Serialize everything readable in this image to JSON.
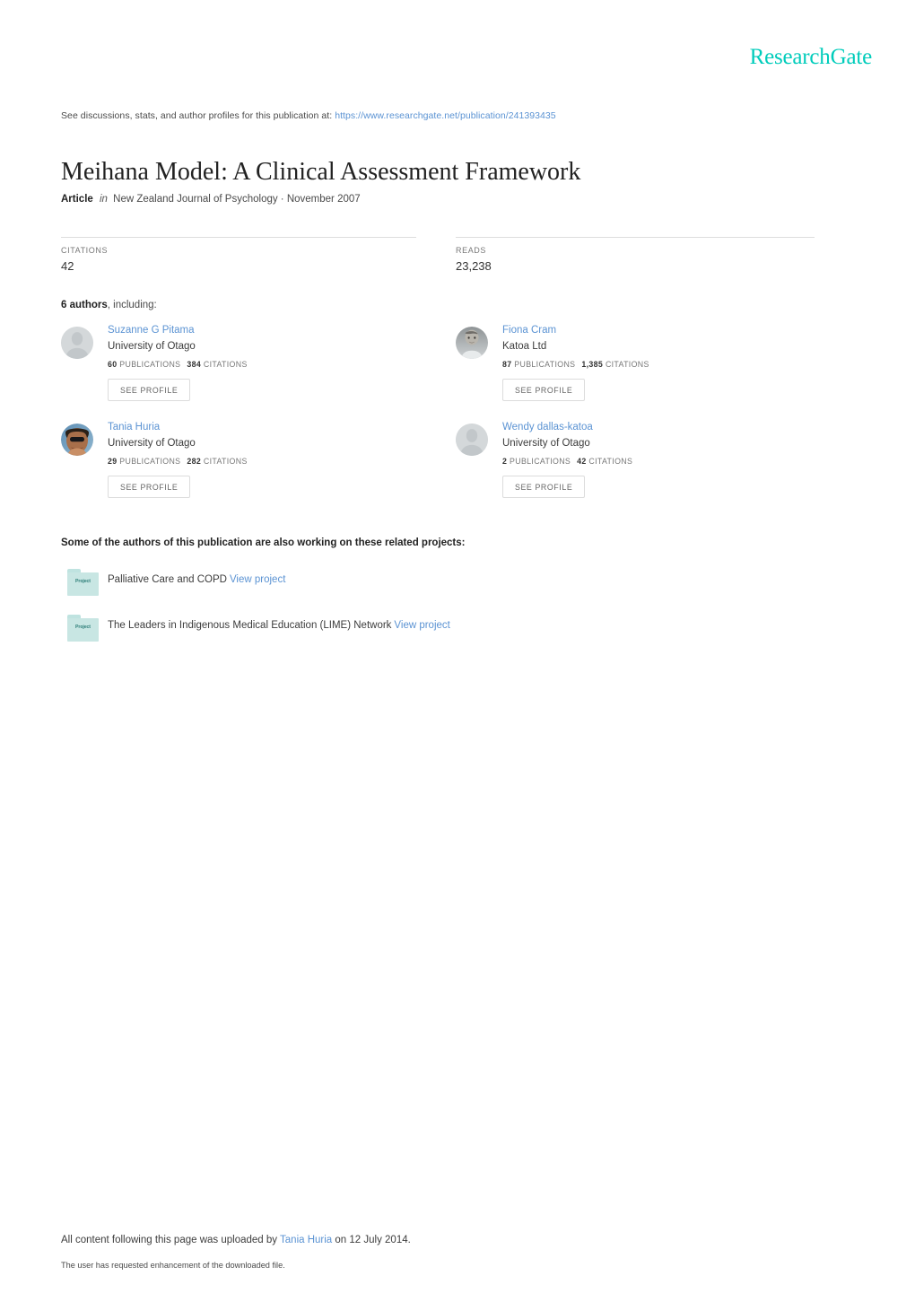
{
  "brand": {
    "logo_text": "ResearchGate",
    "logo_color": "#00ccbb"
  },
  "header": {
    "discussions_prefix": "See discussions, stats, and author profiles for this publication at:",
    "publication_url": "https://www.researchgate.net/publication/241393435"
  },
  "publication": {
    "title": "Meihana Model: A Clinical Assessment Framework",
    "type_label": "Article",
    "in_word": "in",
    "venue_and_date": "New Zealand Journal of Psychology · November 2007"
  },
  "stats": {
    "citations_label": "CITATIONS",
    "citations_value": "42",
    "reads_label": "READS",
    "reads_value": "23,238"
  },
  "authors_section": {
    "count_text": "6 authors",
    "including_text": ", including:",
    "see_profile_label": "SEE PROFILE",
    "publications_label": "PUBLICATIONS",
    "citations_label": "CITATIONS",
    "authors": [
      {
        "name": "Suzanne G Pitama",
        "affiliation": "University of Otago",
        "publications": "60",
        "citations": "384",
        "avatar": "generic-avatar"
      },
      {
        "name": "Fiona Cram",
        "affiliation": "Katoa Ltd",
        "publications": "87",
        "citations": "1,385",
        "avatar": "photo-avatar"
      },
      {
        "name": "Tania Huria",
        "affiliation": "University of Otago",
        "publications": "29",
        "citations": "282",
        "avatar": "photo-avatar"
      },
      {
        "name": "Wendy dallas-katoa",
        "affiliation": "University of Otago",
        "publications": "2",
        "citations": "42",
        "avatar": "generic-avatar"
      }
    ]
  },
  "projects_section": {
    "heading": "Some of the authors of this publication are also working on these related projects:",
    "icon_label": "Project",
    "view_project_label": "View project",
    "projects": [
      {
        "title": "Palliative Care and COPD"
      },
      {
        "title": "The Leaders in Indigenous Medical Education (LIME) Network"
      }
    ]
  },
  "footer": {
    "upload_prefix": "All content following this page was uploaded by",
    "uploader": "Tania Huria",
    "upload_suffix": "on 12 July 2014.",
    "enhancement_note": "The user has requested enhancement of the downloaded file."
  }
}
